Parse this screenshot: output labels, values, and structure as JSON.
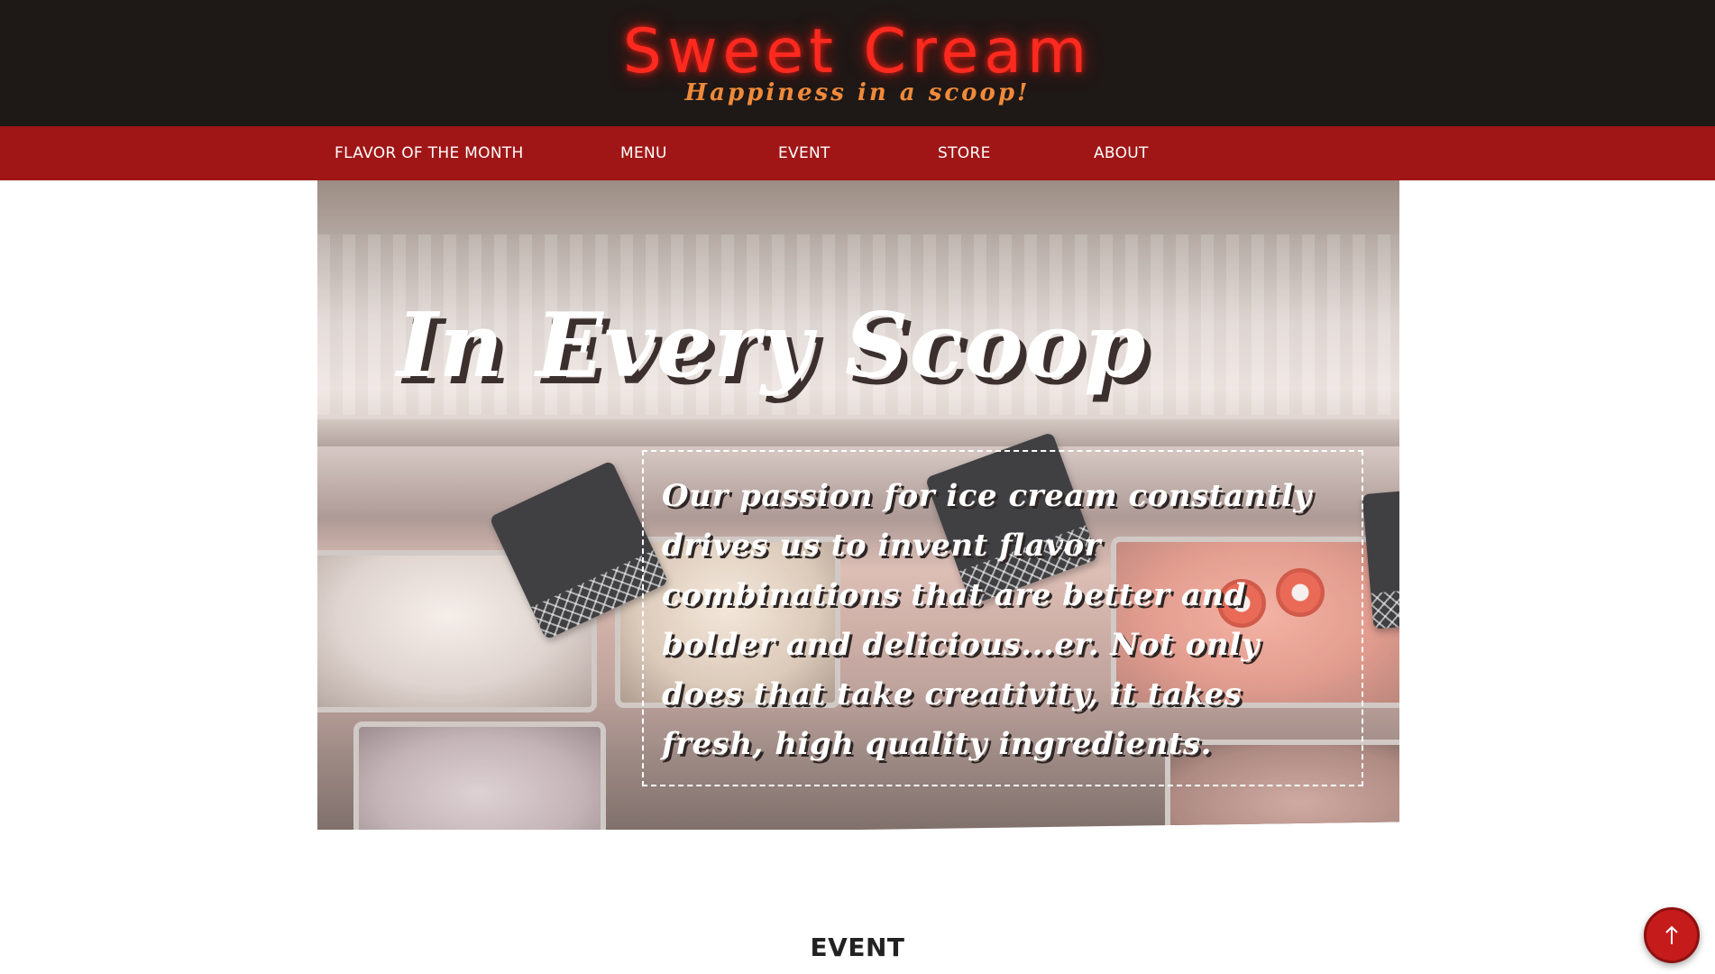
{
  "header": {
    "brand_title": "Sweet Cream",
    "tagline": "Happiness in a scoop!"
  },
  "nav": {
    "items": [
      {
        "label": "FLAVOR OF THE MONTH"
      },
      {
        "label": "MENU"
      },
      {
        "label": "EVENT"
      },
      {
        "label": "STORE"
      },
      {
        "label": "ABOUT"
      }
    ]
  },
  "hero": {
    "heading": "In Every Scoop",
    "quote": "Our passion for ice cream constantly drives us to invent flavor combinations that are better and bolder and delicious...er. Not only does that take creativity, it takes fresh, high quality ingredients."
  },
  "section": {
    "title": "EVENT"
  },
  "back_to_top": {
    "icon": "arrow-up-icon"
  },
  "colors": {
    "header_bg": "#1e1816",
    "brand_neon": "#ff2a1f",
    "tagline": "#f08a3a",
    "nav_bg": "#a01616",
    "back_to_top_bg": "#c51b1b"
  }
}
